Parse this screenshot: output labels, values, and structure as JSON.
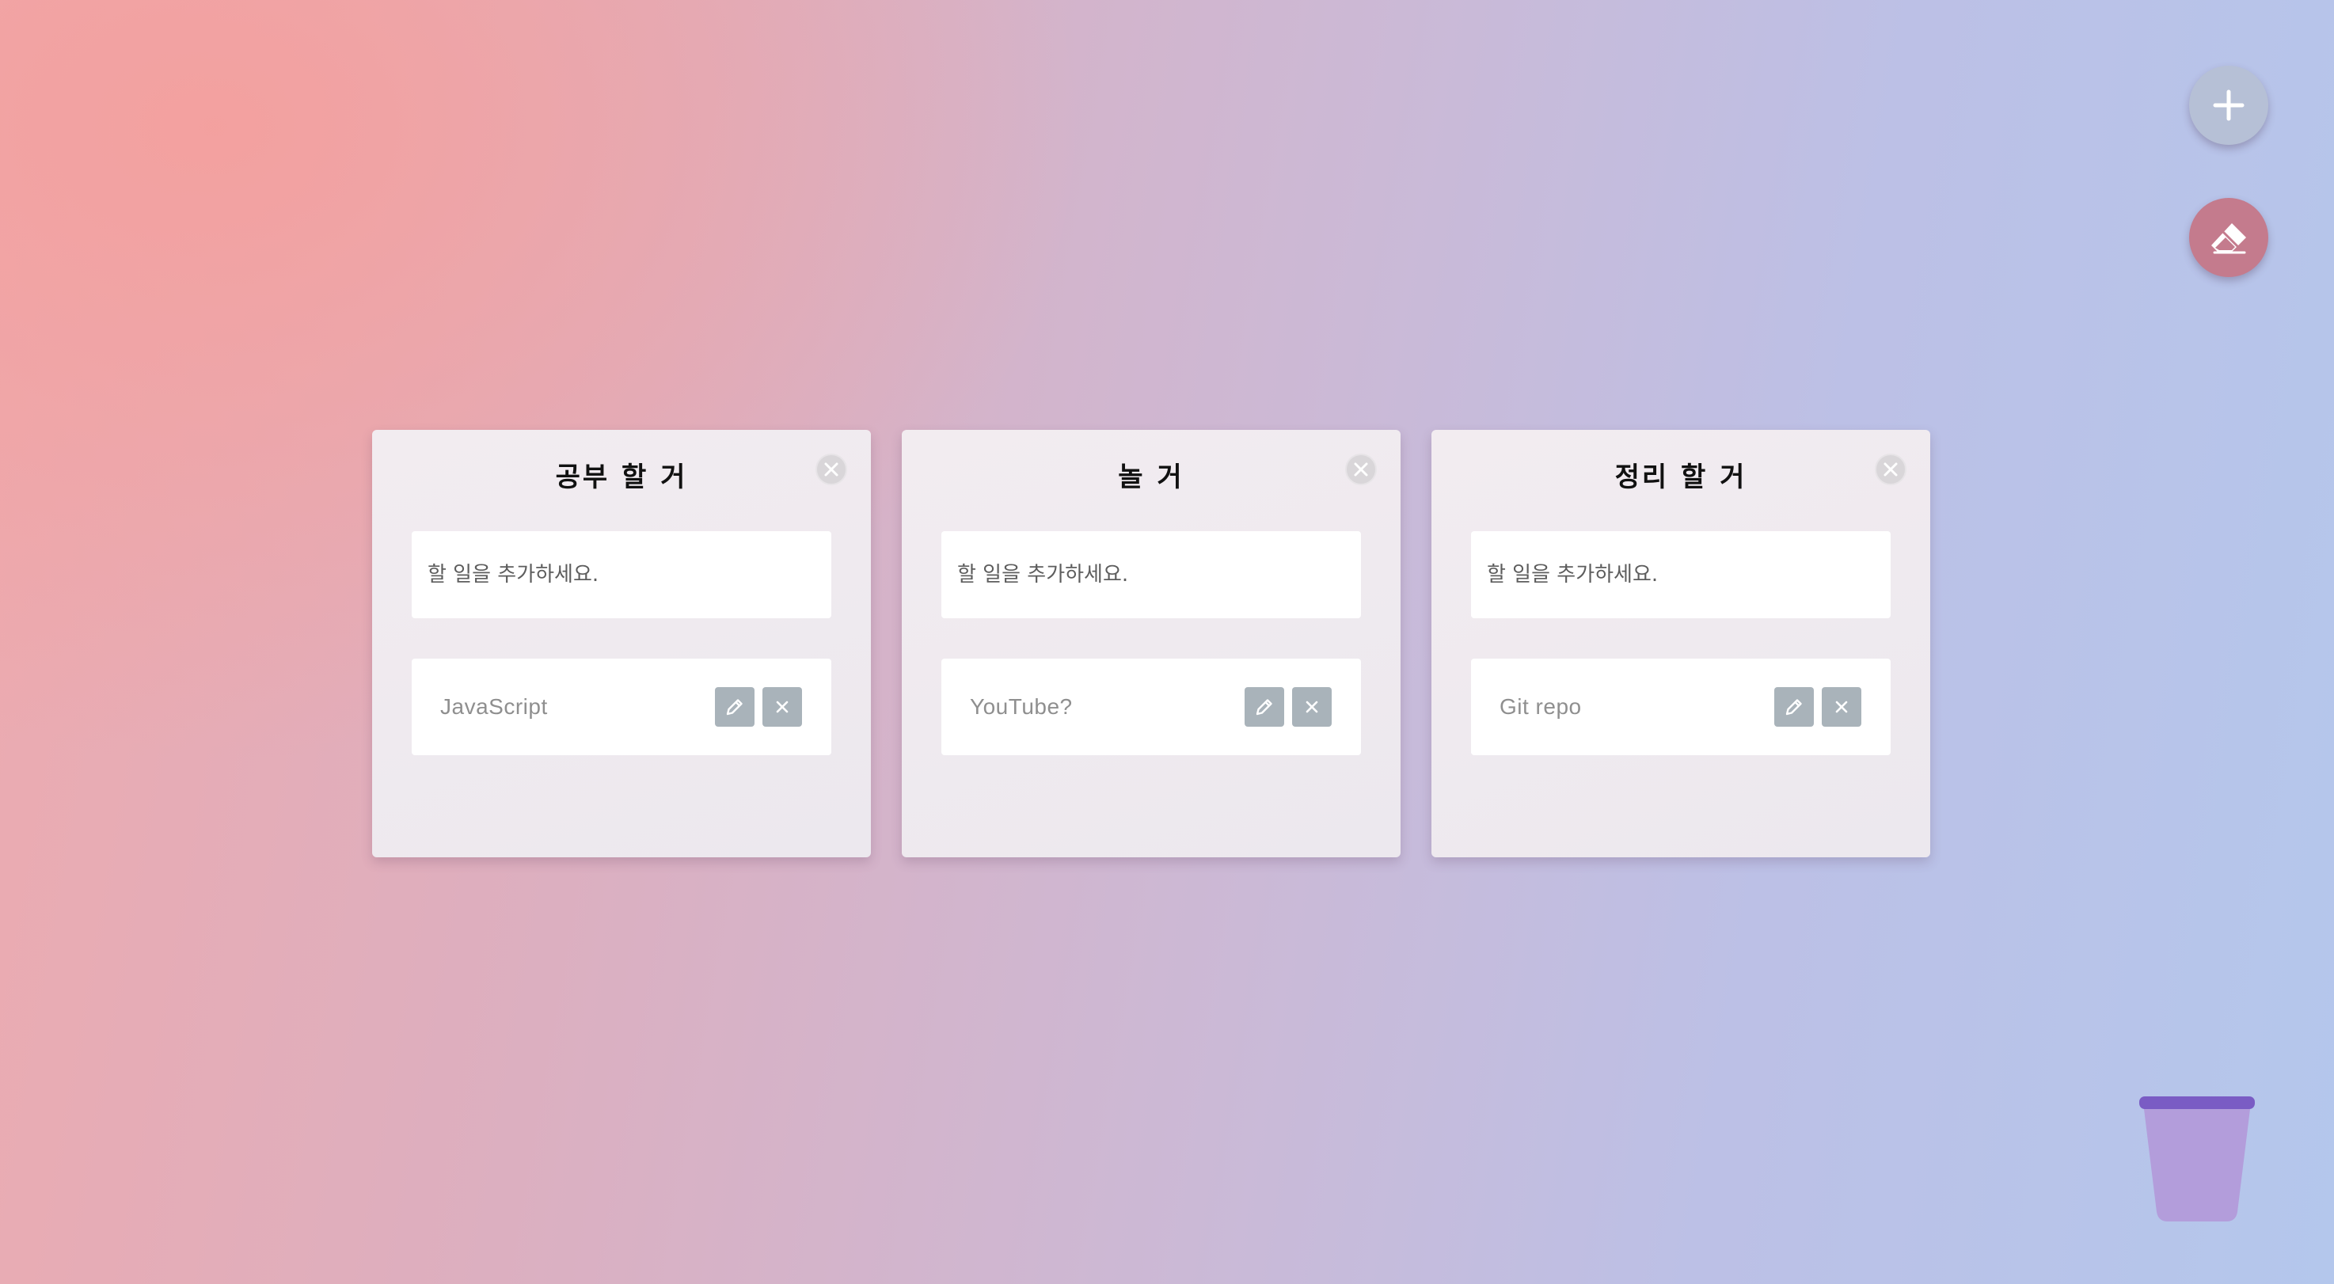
{
  "app": {
    "add_button_icon": "plus-icon",
    "erase_button_icon": "eraser-icon",
    "trash_icon": "trash-can-icon",
    "colors": {
      "add_button": "#b6c0d6",
      "erase_button": "#c47b8d",
      "trash": "#b39ddb",
      "trash_rim": "#7a5cc4",
      "action_button": "#a9b3ba"
    }
  },
  "boards": [
    {
      "title": "공부 할 거",
      "input_placeholder": "할 일을 추가하세요.",
      "tasks": [
        {
          "text": "JavaScript"
        }
      ]
    },
    {
      "title": "놀 거",
      "input_placeholder": "할 일을 추가하세요.",
      "tasks": [
        {
          "text": "YouTube?"
        }
      ]
    },
    {
      "title": "정리 할 거",
      "input_placeholder": "할 일을 추가하세요.",
      "tasks": [
        {
          "text": "Git repo"
        }
      ]
    }
  ]
}
